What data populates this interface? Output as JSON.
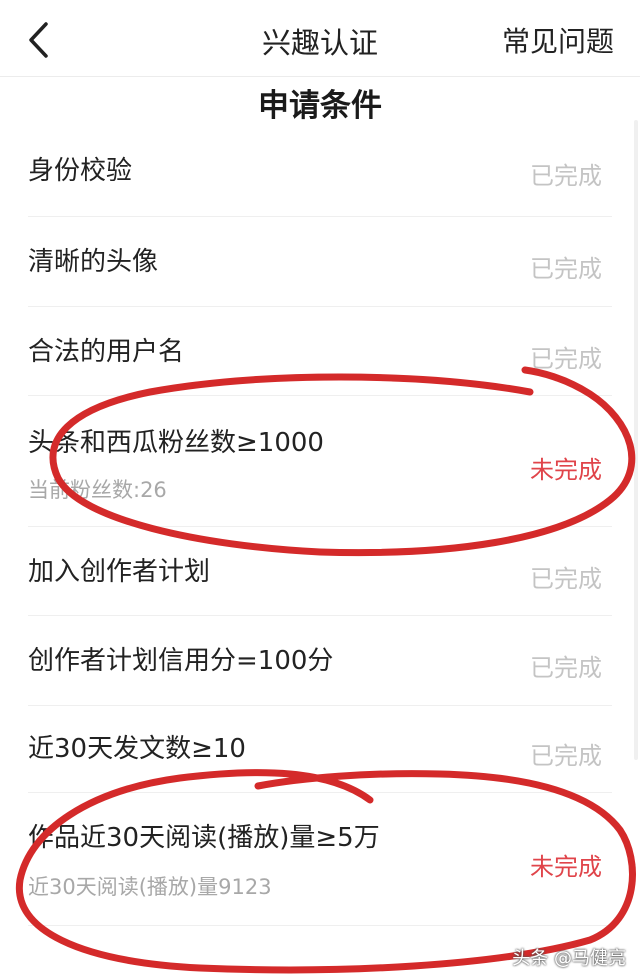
{
  "nav": {
    "back_icon": "chevron-left-icon",
    "title": "兴趣认证",
    "faq_label": "常见问题"
  },
  "section_title": "申请条件",
  "items": [
    {
      "label": "身份校验",
      "status": "已完成",
      "done": true
    },
    {
      "label": "清晰的头像",
      "status": "已完成",
      "done": true
    },
    {
      "label": "合法的用户名",
      "status": "已完成",
      "done": true
    },
    {
      "label": "头条和西瓜粉丝数≥1000",
      "sub": "当前粉丝数:26",
      "status": "未完成",
      "done": false
    },
    {
      "label": "加入创作者计划",
      "status": "已完成",
      "done": true
    },
    {
      "label": "创作者计划信用分=100分",
      "status": "已完成",
      "done": true
    },
    {
      "label": "近30天发文数≥10",
      "status": "已完成",
      "done": true
    },
    {
      "label": "作品近30天阅读(播放)量≥5万",
      "sub": "近30天阅读(播放)量9123",
      "status": "未完成",
      "done": false
    }
  ],
  "watermark": "头条 @马健亮",
  "colors": {
    "done": "#c4c4c4",
    "not_done": "#e0444a",
    "annotation_stroke": "#d42a2a"
  }
}
